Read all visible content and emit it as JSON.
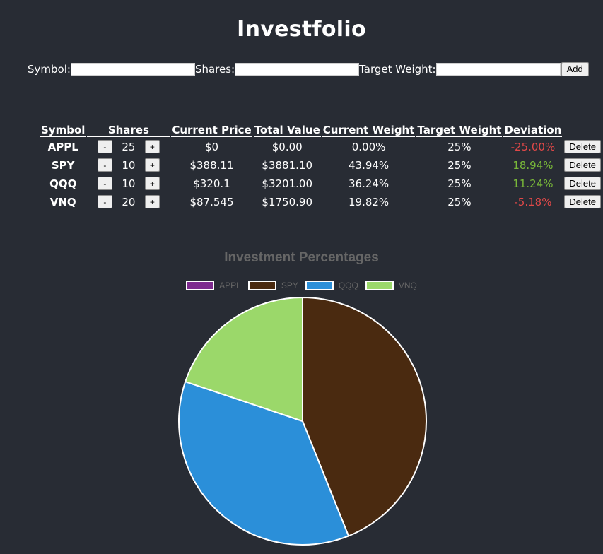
{
  "app": {
    "title": "Investfolio"
  },
  "form": {
    "symbol_label": "Symbol:",
    "shares_label": "Shares:",
    "target_weight_label": "Target Weight:",
    "symbol_value": "",
    "shares_value": "",
    "target_weight_value": "",
    "add_label": "Add"
  },
  "table": {
    "headers": [
      "Symbol",
      "Shares",
      "Current Price",
      "Total Value",
      "Current Weight",
      "Target Weight",
      "Deviation"
    ],
    "minus_label": "-",
    "plus_label": "+",
    "delete_label": "Delete",
    "rows": [
      {
        "symbol": "APPL",
        "shares": "25",
        "current_price": "$0",
        "total_value": "$0.00",
        "current_weight": "0.00%",
        "target_weight": "25%",
        "deviation": "-25.00%",
        "deviation_sign": "negative"
      },
      {
        "symbol": "SPY",
        "shares": "10",
        "current_price": "$388.11",
        "total_value": "$3881.10",
        "current_weight": "43.94%",
        "target_weight": "25%",
        "deviation": "18.94%",
        "deviation_sign": "positive"
      },
      {
        "symbol": "QQQ",
        "shares": "10",
        "current_price": "$320.1",
        "total_value": "$3201.00",
        "current_weight": "36.24%",
        "target_weight": "25%",
        "deviation": "11.24%",
        "deviation_sign": "positive"
      },
      {
        "symbol": "VNQ",
        "shares": "20",
        "current_price": "$87.545",
        "total_value": "$1750.90",
        "current_weight": "19.82%",
        "target_weight": "25%",
        "deviation": "-5.18%",
        "deviation_sign": "negative"
      }
    ]
  },
  "colors": {
    "background": "#282c34",
    "negative": "#e04848",
    "positive": "#79b839",
    "chart_text": "#666666"
  },
  "chart_data": {
    "type": "pie",
    "title": "Investment Percentages",
    "legend_position": "top",
    "categories": [
      "APPL",
      "SPY",
      "QQQ",
      "VNQ"
    ],
    "values": [
      0.0,
      3881.1,
      3201.0,
      1750.9
    ],
    "colors": [
      "#7d2a8e",
      "#4a2a10",
      "#2b8fd9",
      "#9bd86a"
    ]
  }
}
